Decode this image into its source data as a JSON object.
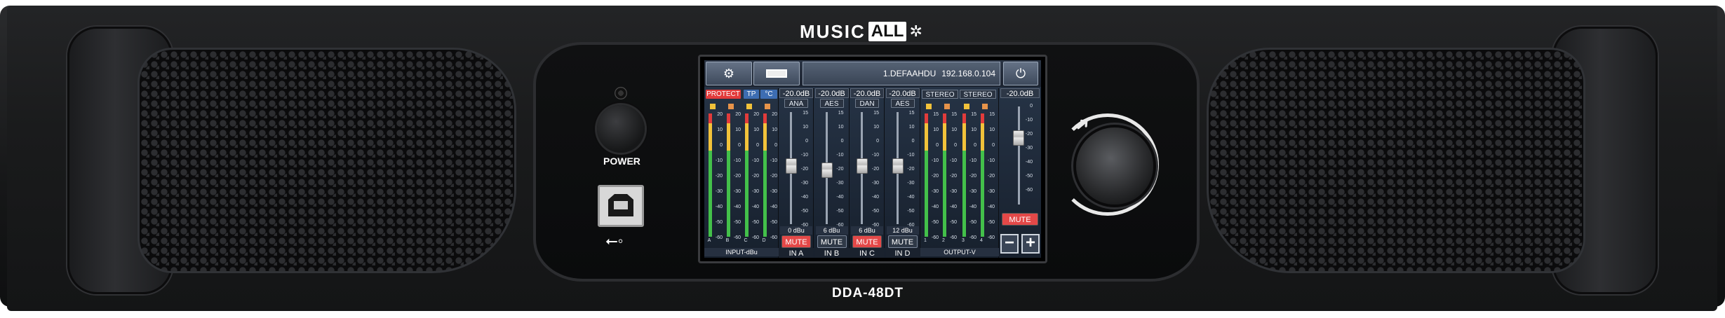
{
  "brand": {
    "left": "MUSIC",
    "right": "ALL"
  },
  "model": "DDA-48DT",
  "front_panel": {
    "power_label": "POWER",
    "usb_symbol": "⭠"
  },
  "screen": {
    "device_name": "1.DEFAAHDU",
    "ip": "192.168.0.104",
    "input_meters": {
      "tags": [
        "PROTECT",
        "TP",
        "°C"
      ],
      "scale": [
        "20",
        "10",
        "0",
        "-10",
        "-20",
        "-30",
        "-40",
        "-50",
        "-60"
      ],
      "channels": [
        "A",
        "B",
        "C",
        "D"
      ],
      "footer": "INPUT-dBu"
    },
    "input_strips": [
      {
        "gain": "-20.0dB",
        "source": "ANA",
        "level": "0 dBu",
        "mute": "MUTE",
        "mute_on": true,
        "name": "IN A"
      },
      {
        "gain": "-20.0dB",
        "source": "AES",
        "level": "6 dBu",
        "mute": "MUTE",
        "mute_on": false,
        "name": "IN B"
      },
      {
        "gain": "-20.0dB",
        "source": "DAN",
        "level": "6 dBu",
        "mute": "MUTE",
        "mute_on": true,
        "name": "IN C"
      },
      {
        "gain": "-20.0dB",
        "source": "AES",
        "level": "12 dBu",
        "mute": "MUTE",
        "mute_on": false,
        "name": "IN D"
      }
    ],
    "fader_scale": [
      "15",
      "10",
      "0",
      "-10",
      "-20",
      "-30",
      "-40",
      "-50",
      "-60"
    ],
    "output_meters": {
      "tags": [
        "STEREO",
        "STEREO"
      ],
      "scale": [
        "15",
        "10",
        "0",
        "-10",
        "-20",
        "-30",
        "-40",
        "-50",
        "-60"
      ],
      "channels": [
        "1",
        "2",
        "3",
        "4"
      ],
      "footer": "OUTPUT-V"
    },
    "master": {
      "gain": "-20.0dB",
      "scale": [
        "0",
        "-10",
        "-20",
        "-30",
        "-40",
        "-50",
        "-60"
      ],
      "mute": "MUTE",
      "minus": "−",
      "plus": "+"
    }
  },
  "colors": {
    "accent_red": "#e23b3b",
    "tag_blue": "#3d6db2",
    "meter_yellow": "#f2c23a"
  }
}
